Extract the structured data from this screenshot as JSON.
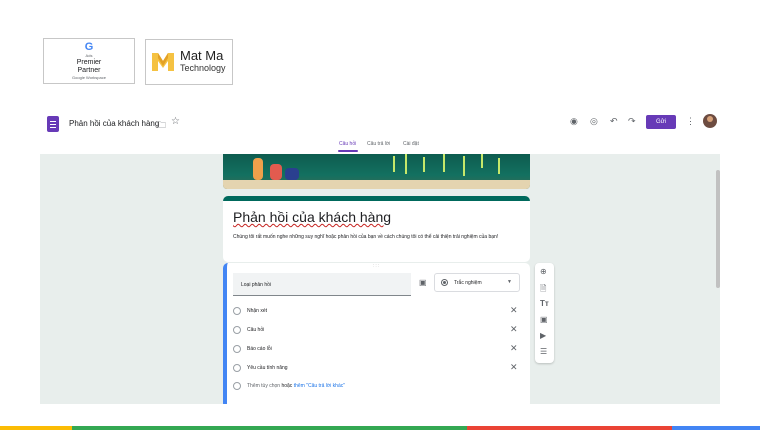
{
  "badges": {
    "google": {
      "logo_letter": "G",
      "small": "Ads",
      "line1": "Premier",
      "line2": "Partner",
      "line3": "Google Workspace"
    },
    "matma": {
      "line1": "Mat Ma",
      "line2": "Technology",
      "logo_colors": [
        "#f5c242",
        "#e3a126"
      ]
    }
  },
  "topbar": {
    "doc_title": "Phản hồi của khách hàng",
    "folder_icon": "folder-icon",
    "star_icon": "star-icon",
    "tools": [
      "palette-icon",
      "preview-eye-icon",
      "undo-icon",
      "redo-icon"
    ],
    "send_label": "Gửi",
    "more_icon": "more-vert-icon"
  },
  "tabs": [
    {
      "label": "Câu hỏi",
      "active": true
    },
    {
      "label": "Câu trả lời",
      "active": false
    },
    {
      "label": "Cài đặt",
      "active": false
    }
  ],
  "form": {
    "title": "Phản hồi của khách hàng",
    "description": "Chúng tôi rất muốn nghe những suy nghĩ hoặc phản hồi của bạn về cách chúng tôi có thể cải thiện trải nghiệm của bạn!",
    "question": {
      "drag_handle": ":::",
      "title": "Loại phản hồi",
      "type": "Trắc nghiệm",
      "options": [
        "Nhận xét",
        "Câu hỏi",
        "Báo cáo lỗi",
        "Yêu cầu tính năng"
      ],
      "add_option": "Thêm tùy chọn",
      "or": "hoặc",
      "add_other": "thêm \"Câu trả lời khác\""
    }
  },
  "side_toolbar": [
    "add-question-icon",
    "import-questions-icon",
    "add-title-icon",
    "add-image-icon",
    "add-video-icon",
    "add-section-icon"
  ],
  "colors": {
    "accent": "#673ab7",
    "header_teal": "#00695c",
    "active_border": "#4285f4",
    "canvas_bg": "#e8eeec",
    "stripe": [
      "#fbbc04",
      "#34a853",
      "#ea4335",
      "#4285f4"
    ]
  }
}
